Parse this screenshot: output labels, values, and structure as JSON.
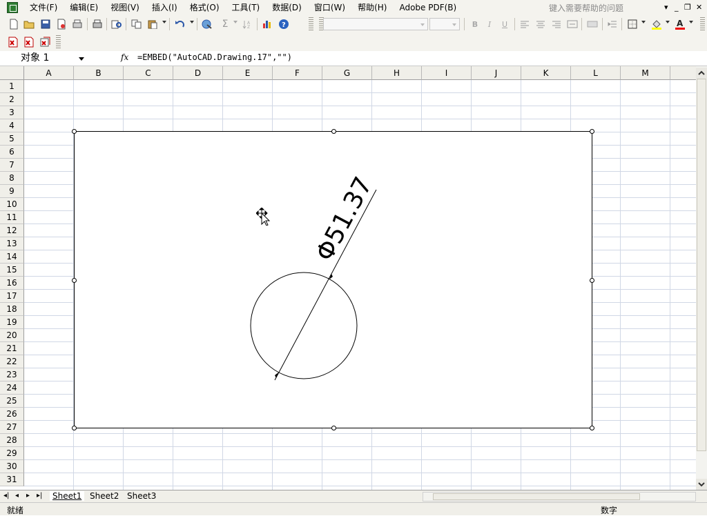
{
  "menubar": {
    "items": [
      "文件(F)",
      "编辑(E)",
      "视图(V)",
      "插入(I)",
      "格式(O)",
      "工具(T)",
      "数据(D)",
      "窗口(W)",
      "帮助(H)",
      "Adobe PDF(B)"
    ],
    "help_placeholder": "键入需要帮助的问题"
  },
  "formula_bar": {
    "name_box": "对象 1",
    "fx_label": "fx",
    "formula": "=EMBED(\"AutoCAD.Drawing.17\",\"\")"
  },
  "grid": {
    "columns": [
      "A",
      "B",
      "C",
      "D",
      "E",
      "F",
      "G",
      "H",
      "I",
      "J",
      "K",
      "L",
      "M"
    ],
    "rows": [
      "1",
      "2",
      "3",
      "4",
      "5",
      "6",
      "7",
      "8",
      "9",
      "10",
      "11",
      "12",
      "13",
      "14",
      "15",
      "16",
      "17",
      "18",
      "19",
      "20",
      "21",
      "22",
      "23",
      "24",
      "25",
      "26",
      "27",
      "28",
      "29",
      "30",
      "31"
    ]
  },
  "drawing": {
    "dimension_text": "Φ51.37"
  },
  "sheet_tabs": [
    "Sheet1",
    "Sheet2",
    "Sheet3"
  ],
  "statusbar": {
    "left": "就绪",
    "right": "数字"
  },
  "colors": {
    "chrome": "#f4f3ee",
    "gridline": "#d0d7e5",
    "header": "#f0efe9"
  }
}
